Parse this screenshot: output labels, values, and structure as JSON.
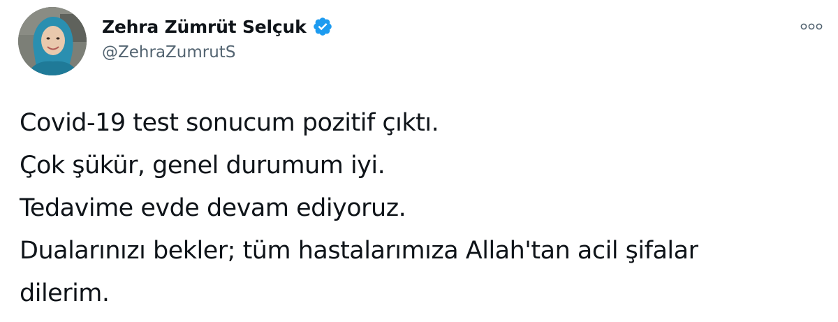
{
  "tweet": {
    "author": {
      "display_name": "Zehra Zümrüt Selçuk",
      "handle": "@ZehraZumrutS",
      "verified": true
    },
    "text_lines": [
      "Covid-19 test sonucum pozitif çıktı.",
      "Çok şükür, genel durumum iyi.",
      "Tedavime evde devam ediyoruz.",
      "Dualarınızı bekler; tüm hastalarımıza Allah'tan acil şifalar",
      "dilerim."
    ]
  },
  "colors": {
    "text": "#0f1419",
    "secondary": "#536471",
    "verified": "#1d9bf0"
  },
  "icons": {
    "verified": "verified-badge-icon",
    "more": "more-options-icon"
  }
}
